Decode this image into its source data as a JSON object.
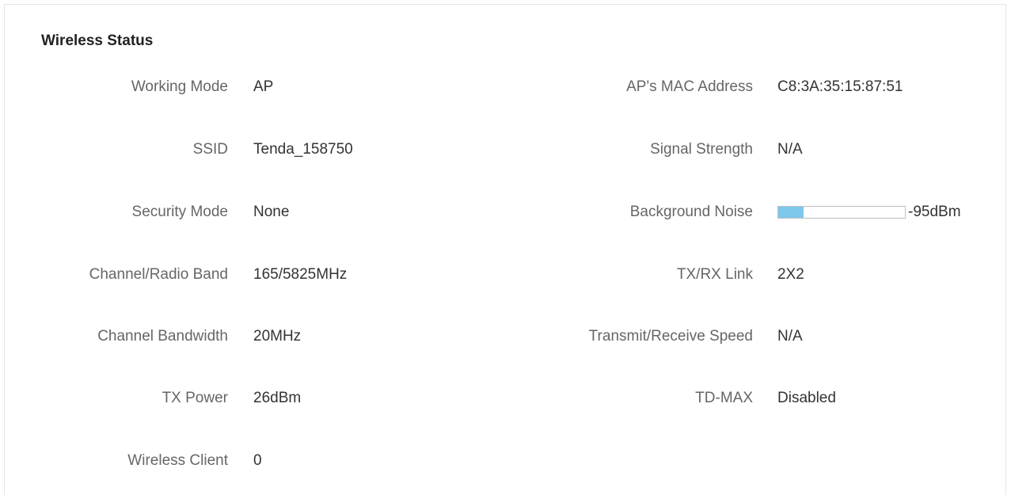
{
  "title": "Wireless Status",
  "left": [
    {
      "label": "Working Mode",
      "value": "AP"
    },
    {
      "label": "SSID",
      "value": "Tenda_158750"
    },
    {
      "label": "Security Mode",
      "value": "None"
    },
    {
      "label": "Channel/Radio Band",
      "value": "165/5825MHz"
    },
    {
      "label": "Channel Bandwidth",
      "value": "20MHz"
    },
    {
      "label": "TX Power",
      "value": "26dBm"
    },
    {
      "label": "Wireless Client",
      "value": "0"
    }
  ],
  "right": [
    {
      "label": "AP's MAC Address",
      "value": "C8:3A:35:15:87:51"
    },
    {
      "label": "Signal Strength",
      "value": "N/A"
    },
    {
      "label": "Background Noise",
      "value": "-95dBm",
      "fill_fraction": 0.2,
      "fill_color": "#7ec8ec"
    },
    {
      "label": "TX/RX Link",
      "value": "2X2"
    },
    {
      "label": "Transmit/Receive Speed",
      "value": "N/A"
    },
    {
      "label": "TD-MAX",
      "value": "Disabled"
    }
  ]
}
